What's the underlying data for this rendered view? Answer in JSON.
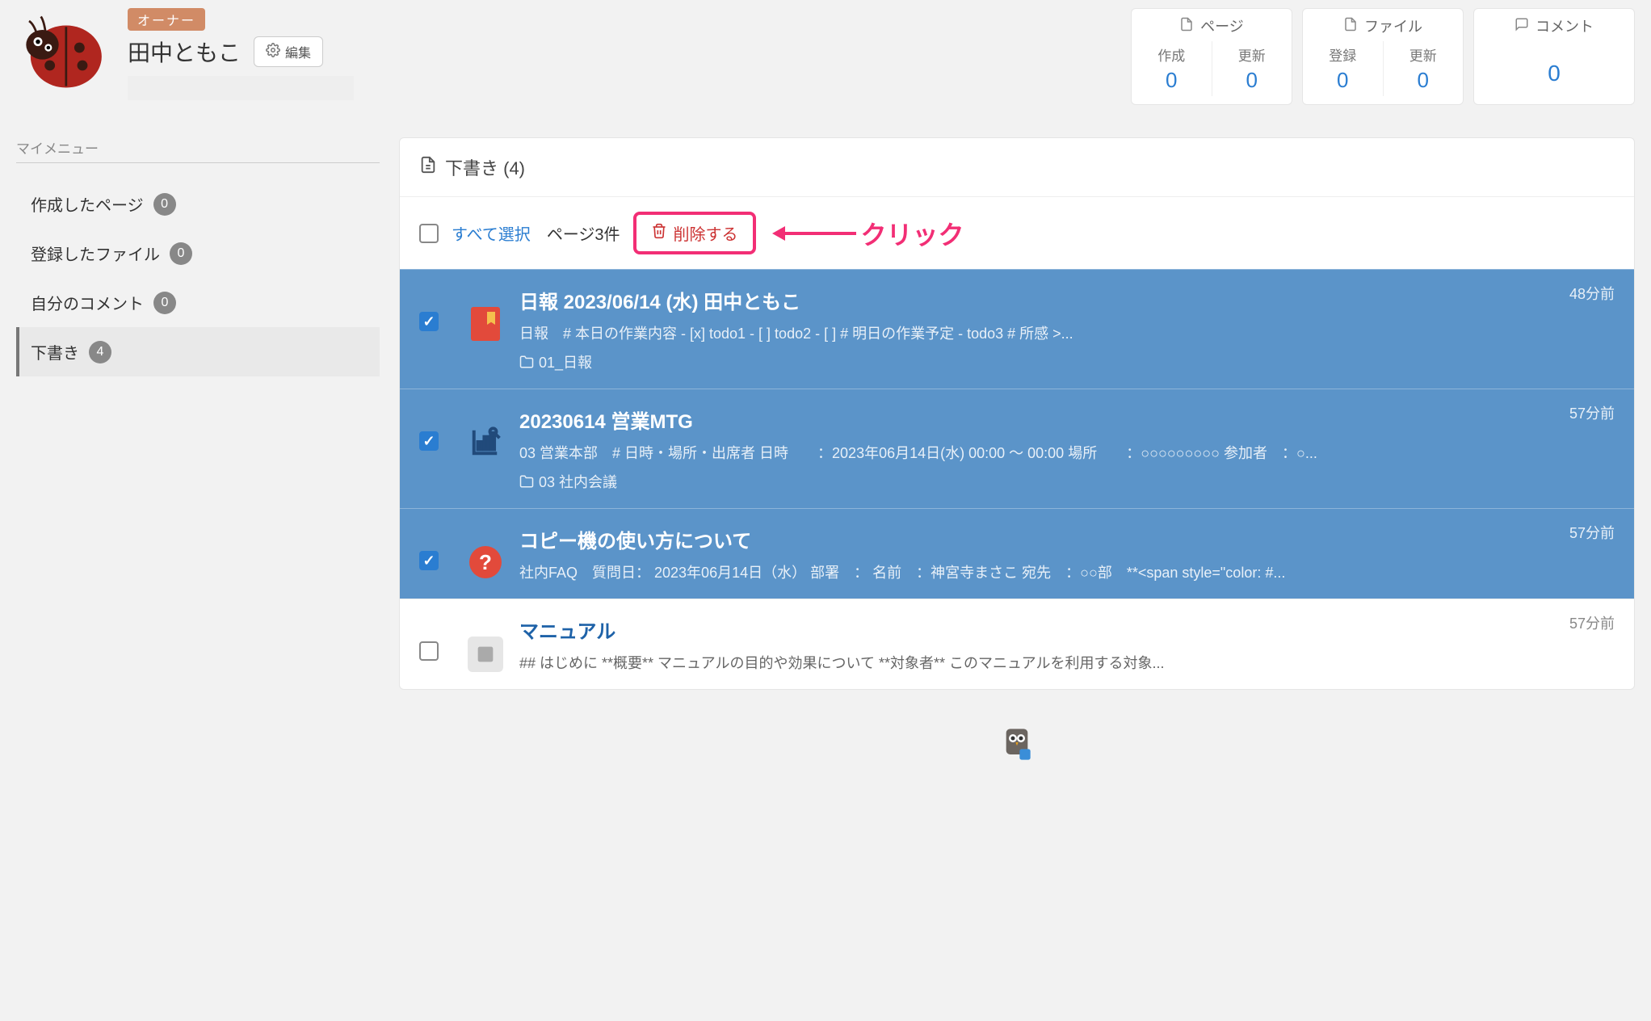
{
  "profile": {
    "owner_badge": "オーナー",
    "username": "田中ともこ",
    "edit_label": "編集"
  },
  "stats": {
    "page": {
      "title": "ページ",
      "col1_label": "作成",
      "col1_value": "0",
      "col2_label": "更新",
      "col2_value": "0"
    },
    "file": {
      "title": "ファイル",
      "col1_label": "登録",
      "col1_value": "0",
      "col2_label": "更新",
      "col2_value": "0"
    },
    "comment": {
      "title": "コメント",
      "value": "0"
    }
  },
  "sidebar": {
    "title": "マイメニュー",
    "items": [
      {
        "label": "作成したページ",
        "badge": "0"
      },
      {
        "label": "登録したファイル",
        "badge": "0"
      },
      {
        "label": "自分のコメント",
        "badge": "0"
      },
      {
        "label": "下書き",
        "badge": "4"
      }
    ]
  },
  "panel": {
    "title": "下書き (4)",
    "select_all": "すべて選択",
    "page_count": "ページ3件",
    "delete_label": "削除する",
    "annotation": "クリック"
  },
  "rows": [
    {
      "selected": true,
      "icon": "red-doc",
      "title": "日報 2023/06/14 (水) 田中ともこ",
      "excerpt": "日報　# 本日の作業内容 - [x] todo1 - [ ] todo2 - [ ] # 明日の作業予定 - todo3 # 所感 >...",
      "folder": "01_日報",
      "time": "48分前"
    },
    {
      "selected": true,
      "icon": "chart",
      "title": "20230614 営業MTG",
      "excerpt": "03 営業本部　# 日時・場所・出席者 日時　　：2023年06月14日(水) 00:00 〜 00:00 場所　　：○○○○○○○○○ 参加者　：○...",
      "folder": "03 社内会議",
      "time": "57分前"
    },
    {
      "selected": true,
      "icon": "question",
      "title": "コピー機の使い方について",
      "excerpt": "社内FAQ　質問日： 2023年06月14日（水） 部署　： 名前　：神宮寺まさこ 宛先　：○○部　**<span style=\"color: #...",
      "folder": "",
      "time": "57分前"
    },
    {
      "selected": false,
      "icon": "gray",
      "title": "マニュアル",
      "excerpt": "## はじめに **概要** マニュアルの目的や効果について **対象者** このマニュアルを利用する対象...",
      "folder": "",
      "time": "57分前"
    }
  ]
}
